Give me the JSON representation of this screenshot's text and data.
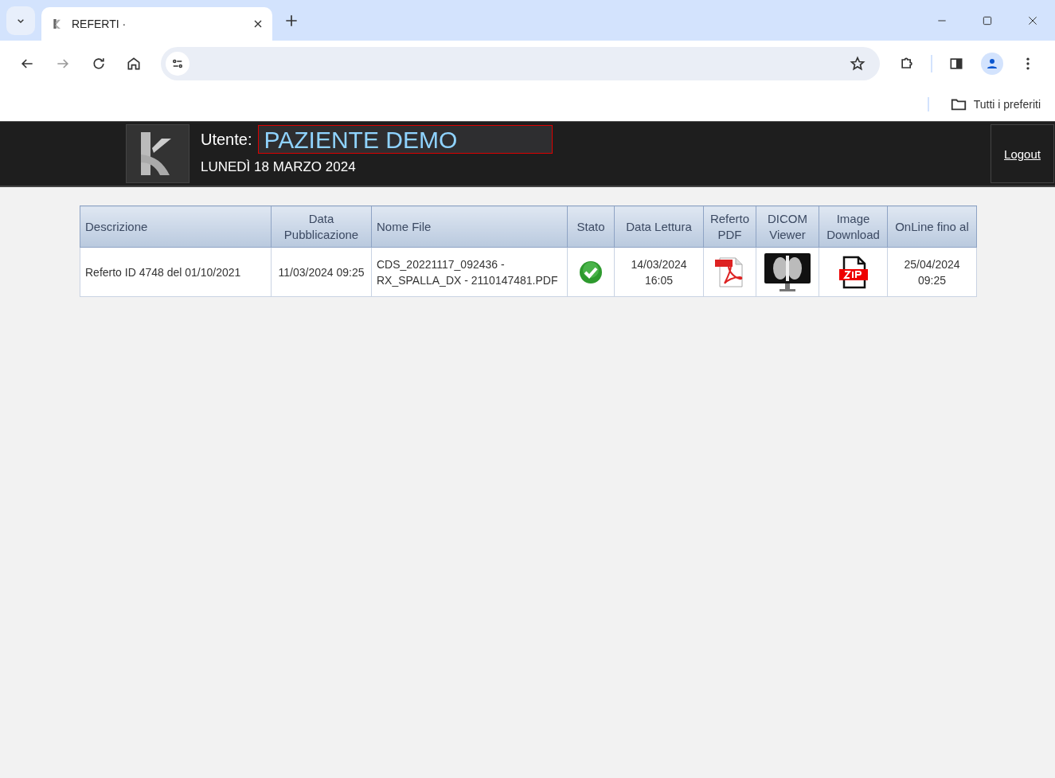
{
  "browser": {
    "tab_title": "REFERTI ·",
    "bookmarks_label": "Tutti i preferiti"
  },
  "header": {
    "user_label": "Utente:",
    "user_name": "PAZIENTE DEMO",
    "date": "LUNEDÌ 18 MARZO 2024",
    "logout": "Logout"
  },
  "table": {
    "columns": [
      "Descrizione",
      "Data Pubblicazione",
      "Nome File",
      "Stato",
      "Data Lettura",
      "Referto PDF",
      "DICOM Viewer",
      "Image Download",
      "OnLine fino al"
    ],
    "rows": [
      {
        "cells": [
          {
            "kind": "text",
            "text": "Referto ID 4748 del 01/10/2021"
          },
          {
            "kind": "text",
            "text": "11/03/2024 09:25"
          },
          {
            "kind": "text",
            "text": "CDS_20221117_092436 - RX_SPALLA_DX - 2110147481.PDF"
          },
          {
            "kind": "status",
            "done": true
          },
          {
            "kind": "text",
            "text": "14/03/2024 16:05"
          },
          {
            "kind": "pdf"
          },
          {
            "kind": "dicom"
          },
          {
            "kind": "zip"
          },
          {
            "kind": "text",
            "text": "25/04/2024 09:25"
          }
        ]
      }
    ]
  }
}
